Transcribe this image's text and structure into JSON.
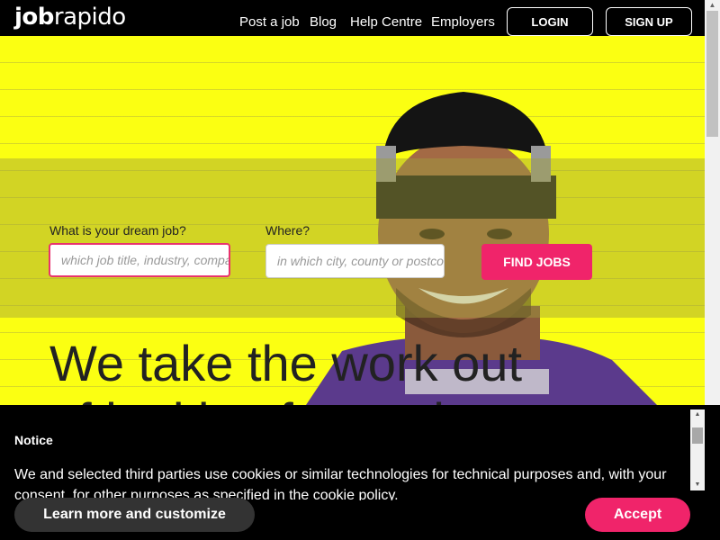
{
  "header": {
    "logo_bold": "job",
    "logo_light": "rapido",
    "nav": [
      "Post a job",
      "Blog",
      "Help Centre",
      "Employers"
    ],
    "login_label": "LOGIN",
    "signup_label": "SIGN UP"
  },
  "search": {
    "job_label": "What is your dream job?",
    "job_placeholder": "which job title, industry, company?",
    "where_label": "Where?",
    "where_placeholder": "in which city, county or postcode?",
    "find_label": "FIND JOBS"
  },
  "hero": {
    "headline_line1": "We take the work out",
    "headline_line2": "of looking for work"
  },
  "cookie": {
    "title": "Notice",
    "text": "We and selected third parties use cookies or similar technologies for technical purposes and, with your consent, for other purposes as specified in the cookie policy.",
    "learn_label": "Learn more and customize",
    "accept_label": "Accept"
  },
  "colors": {
    "brand_pink": "#f0246a",
    "hero_yellow": "#fbff12",
    "header_black": "#000000"
  },
  "icons": {
    "scroll_up": "scroll-up-arrow-icon",
    "scroll_down": "scroll-down-arrow-icon"
  }
}
